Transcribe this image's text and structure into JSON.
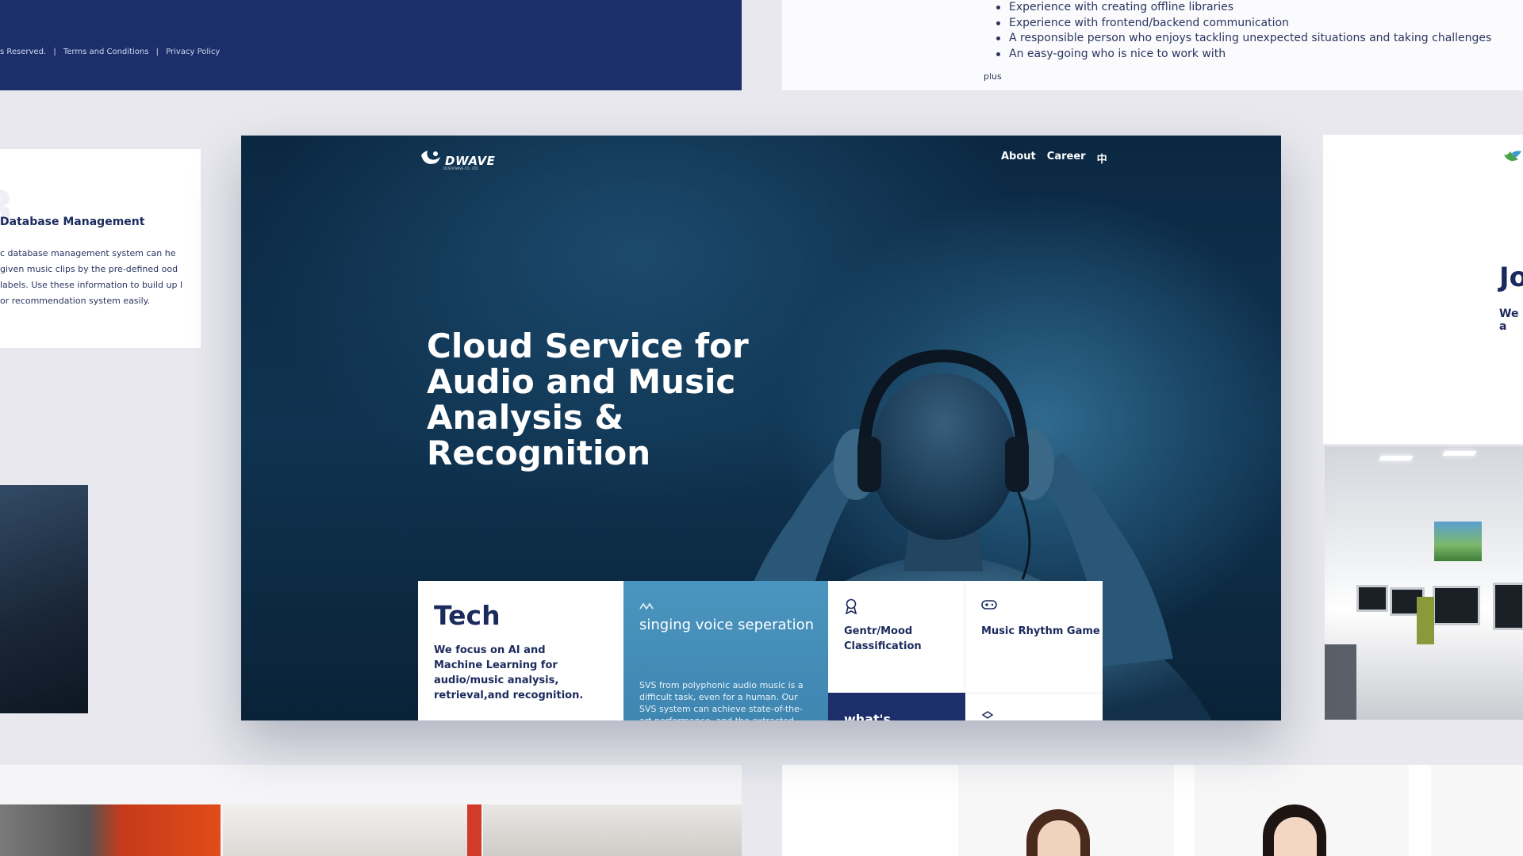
{
  "footer": {
    "reserved": "s Reserved.",
    "sep1": "|",
    "terms": "Terms and Conditions",
    "sep2": "|",
    "privacy": "Privacy Policy"
  },
  "requirements": {
    "items": [
      "Experience with creating offline libraries",
      "Experience with frontend/backend communication",
      "A responsible person who enjoys tackling unexpected situations and taking challenges",
      "An easy-going who is nice to work with"
    ],
    "plus": "plus"
  },
  "db_card": {
    "number": "3",
    "title": "Database Management",
    "text": "c database management system can he given music clips by the pre-defined ood labels. Use these information to build up l or recommendation system easily."
  },
  "right_card": {
    "big_text": "Jo",
    "small_text": "We a"
  },
  "hero": {
    "logo": {
      "name": "DWAVE",
      "sub": "DCSOFWAVE CO., LTD",
      "icon": "wave-bird-icon"
    },
    "nav": {
      "about": "About",
      "career": "Career",
      "lang": "中"
    },
    "title": "Cloud Service for Audio and Music Analysis & Recognition"
  },
  "tiles": {
    "tech": {
      "title": "Tech",
      "text": "We focus on AI and Machine Learning for audio/music analysis, retrieval,and recognition."
    },
    "svs": {
      "icon": "wave-icon",
      "title": "singing voice seperation",
      "text": "SVS from polyphonic audio music is a difficult task, even for a human. Our SVS system can achieve state-of-the-art performance, and the extracted singing"
    },
    "genre": {
      "icon": "award-icon",
      "label": "Gentr/Mood Classification"
    },
    "rhythm": {
      "icon": "gamepad-icon",
      "label": "Music Rhythm Game"
    },
    "whatis": {
      "label": "what's"
    },
    "fourth": {
      "icon": "cube-icon"
    }
  },
  "colors": {
    "navy": "#1c2f6b",
    "hero_bg": "#0b2842",
    "svs_blue": "#4a95bf",
    "page_bg": "#e8e8ee"
  }
}
